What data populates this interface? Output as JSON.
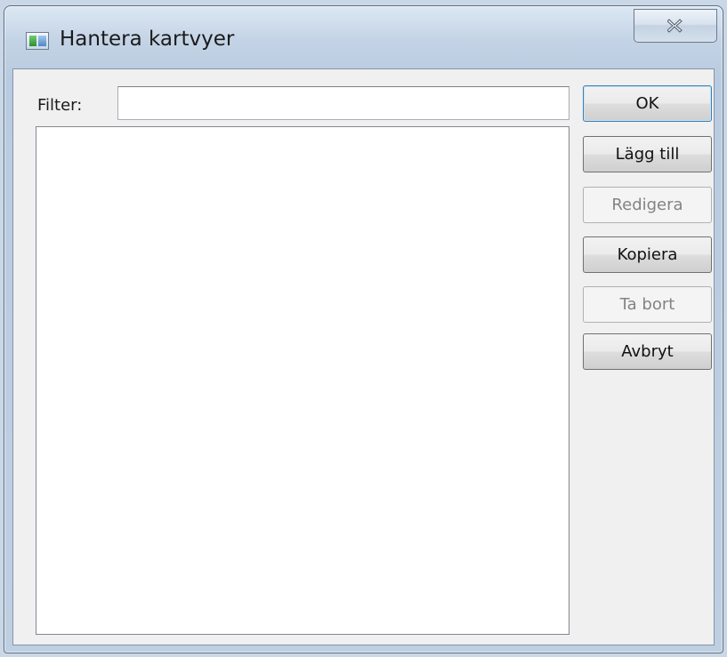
{
  "window": {
    "title": "Hantera kartvyer",
    "close_icon": "close-x-icon",
    "app_icon": "map-view-icon"
  },
  "filter": {
    "label": "Filter:",
    "value": "",
    "placeholder": ""
  },
  "list": {
    "items": []
  },
  "buttons": {
    "ok": {
      "label": "OK",
      "enabled": true
    },
    "add": {
      "label": "Lägg till",
      "enabled": true
    },
    "edit": {
      "label": "Redigera",
      "enabled": false
    },
    "copy": {
      "label": "Kopiera",
      "enabled": true
    },
    "remove": {
      "label": "Ta bort",
      "enabled": false
    },
    "cancel": {
      "label": "Avbryt",
      "enabled": true
    }
  },
  "colors": {
    "titlebar": "#c3d3e5",
    "client_background": "#f0f0f0",
    "disabled_text": "#838383"
  }
}
